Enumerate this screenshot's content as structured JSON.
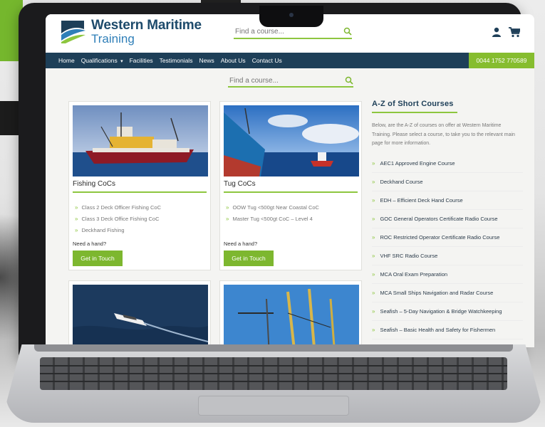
{
  "site": {
    "logo_line1": "Western Maritime",
    "logo_line2": "Training",
    "search_placeholder": "Find a course...",
    "phone": "0044 1752 770589"
  },
  "nav": {
    "items": [
      "Home",
      "Qualifications",
      "Facilities",
      "Testimonials",
      "News",
      "About Us",
      "Contact Us"
    ],
    "dropdown_marker": "▾"
  },
  "cards": [
    {
      "title": "Fishing CoCs",
      "items": [
        "Class 2 Deck Officer Fishing CoC",
        "Class 3 Deck Office Fishing CoC",
        "Deckhand Fishing"
      ],
      "need_text": "Need a hand?",
      "button": "Get in Touch"
    },
    {
      "title": "Tug CoCs",
      "items": [
        "OOW Tug <500gt Near Coastal CoC",
        "Master Tug <500gt CoC – Level 4"
      ],
      "need_text": "Need a hand?",
      "button": "Get in Touch"
    }
  ],
  "sidebar": {
    "title": "A-Z of Short Courses",
    "description": "Below, are the A-Z of courses on offer at Western Maritime Training. Please select a course, to take you to the relevant main page for more information.",
    "courses": [
      "AEC1 Approved Engine Course",
      "Deckhand Course",
      "EDH – Efficient Deck Hand Course",
      "GOC General Operators Certificate Radio Course",
      "ROC Restricted Operator Certificate Radio Course",
      "VHF SRC Radio Course",
      "MCA Oral Exam Preparation",
      "MCA Small Ships Navigation and Radar Course",
      "Seafish – 5-Day Navigation & Bridge Watchkeeping",
      "Seafish – Basic Health and Safety for Fishermen"
    ]
  },
  "colors": {
    "brand_navy": "#1e3f58",
    "brand_green": "#86bd2f",
    "brand_blue": "#2f7fb8"
  },
  "icons": [
    "search-icon",
    "user-icon",
    "cart-icon",
    "chevron-right-icon"
  ]
}
